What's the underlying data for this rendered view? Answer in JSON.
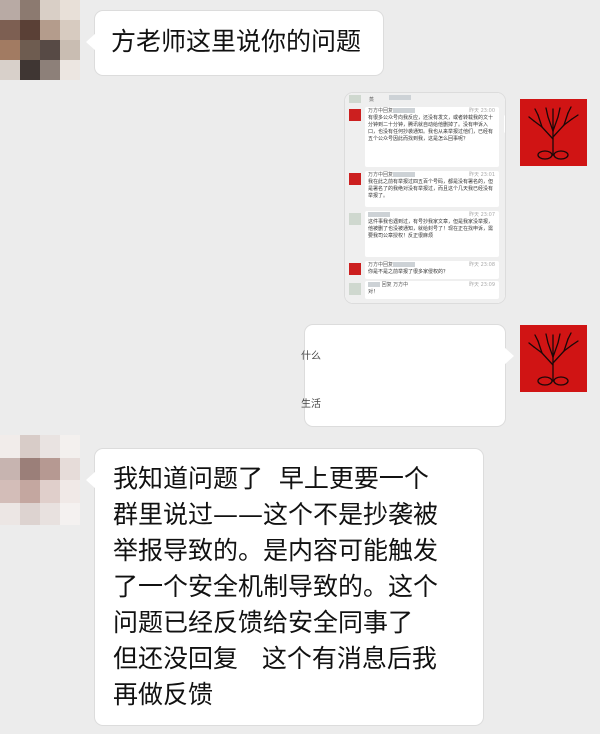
{
  "messages": {
    "top": {
      "text": "方老师这里说你的问题"
    },
    "screenshot": {
      "items": [
        {
          "name": "蒸",
          "time": "",
          "text": ""
        },
        {
          "name": "万方中回复",
          "time": "昨天 23:00",
          "text": "有很多公众号向我反应，还没有发文，或者转载我的文十分钟到二十分钟，腾讯就自动给他删掉了。没有申诉入口，也没有任何抄袭通知。我也从来举报过他们，已经有五个公众号因此而找到我，这是怎么回事呢？"
        },
        {
          "name": "万方中回复",
          "time": "昨天 23:01",
          "text": "我在此之前有举报过四五百个号码，都是没有署名的，但是署名了的我绝对没有举报过，而且这个几天我已经没有举报了。"
        },
        {
          "name": "",
          "time": "昨天 23:07",
          "text": "这件事我也遇到过，有号抄我家文章，但是我家没举报，他被删了也没被通知，就给封号了！现在正在找申诉，需要我司公章授权！反正很麻烦"
        },
        {
          "name": "万方中回复",
          "time": "昨天 23:08",
          "text": "你是不是之前举报了很多家侵权的？"
        },
        {
          "name": "回复 万方中",
          "time": "昨天 23:09",
          "text": "对！"
        }
      ]
    },
    "partial": {
      "line1": "什么",
      "line2": "生活"
    },
    "bottom": {
      "text": "我知道问题了  早上更要一个\n群里说过——这个不是抄袭被\n举报导致的。是内容可能触发\n了一个安全机制导致的。这个\n问题已经反馈给安全同事了\n但还没回复   这个有消息后我\n再做反馈"
    }
  },
  "colors": {
    "background": "#ececec",
    "bubble": "#ffffff",
    "avatar_red": "#d01414"
  }
}
